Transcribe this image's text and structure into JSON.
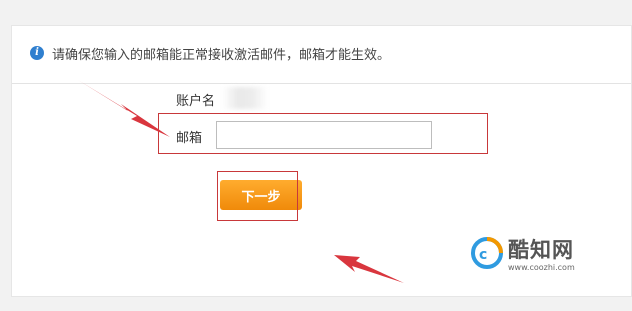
{
  "notice": {
    "icon": "info-icon",
    "text": "请确保您输入的邮箱能正常接收激活邮件，邮箱才能生效。"
  },
  "form": {
    "account_label": "账户名",
    "email_label": "邮箱",
    "email_value": "",
    "next_label": "下一步"
  },
  "watermark": {
    "name": "酷知网",
    "url": "www.coozhi.com"
  },
  "colors": {
    "accent_orange": "#f39800",
    "annotation_red": "#d9363e",
    "info_blue": "#2f7fcf"
  }
}
